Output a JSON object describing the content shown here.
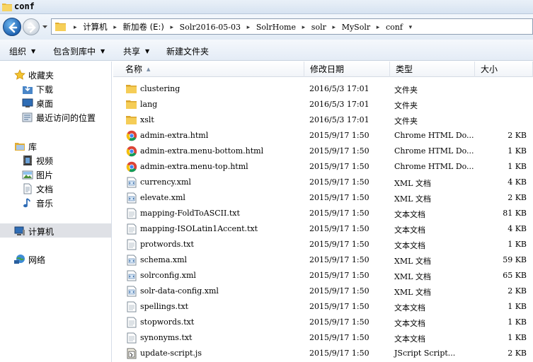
{
  "window": {
    "title": "conf"
  },
  "address": {
    "crumbs": [
      "计算机",
      "新加卷 (E:)",
      "Solr2016-05-03",
      "SolrHome",
      "solr",
      "MySolr",
      "conf"
    ]
  },
  "toolbar": {
    "organize": "组织",
    "include_library": "包含到库中",
    "share": "共享",
    "new_folder": "新建文件夹"
  },
  "nav": {
    "favorites": "收藏夹",
    "downloads": "下载",
    "desktop": "桌面",
    "recent": "最近访问的位置",
    "libraries": "库",
    "videos": "视频",
    "pictures": "图片",
    "documents": "文档",
    "music": "音乐",
    "computer": "计算机",
    "network": "网络"
  },
  "columns": {
    "name": "名称",
    "date": "修改日期",
    "type": "类型",
    "size": "大小"
  },
  "files": [
    {
      "icon": "folder-icon",
      "name": "clustering",
      "date": "2016/5/3 17:01",
      "type": "文件夹",
      "size": ""
    },
    {
      "icon": "folder-icon",
      "name": "lang",
      "date": "2016/5/3 17:01",
      "type": "文件夹",
      "size": ""
    },
    {
      "icon": "folder-icon",
      "name": "xslt",
      "date": "2016/5/3 17:01",
      "type": "文件夹",
      "size": ""
    },
    {
      "icon": "chrome-icon",
      "name": "admin-extra.html",
      "date": "2015/9/17 1:50",
      "type": "Chrome HTML Do...",
      "size": "2 KB"
    },
    {
      "icon": "chrome-icon",
      "name": "admin-extra.menu-bottom.html",
      "date": "2015/9/17 1:50",
      "type": "Chrome HTML Do...",
      "size": "1 KB"
    },
    {
      "icon": "chrome-icon",
      "name": "admin-extra.menu-top.html",
      "date": "2015/9/17 1:50",
      "type": "Chrome HTML Do...",
      "size": "1 KB"
    },
    {
      "icon": "xml-icon",
      "name": "currency.xml",
      "date": "2015/9/17 1:50",
      "type": "XML 文档",
      "size": "4 KB"
    },
    {
      "icon": "xml-icon",
      "name": "elevate.xml",
      "date": "2015/9/17 1:50",
      "type": "XML 文档",
      "size": "2 KB"
    },
    {
      "icon": "text-file-icon",
      "name": "mapping-FoldToASCII.txt",
      "date": "2015/9/17 1:50",
      "type": "文本文档",
      "size": "81 KB"
    },
    {
      "icon": "text-file-icon",
      "name": "mapping-ISOLatin1Accent.txt",
      "date": "2015/9/17 1:50",
      "type": "文本文档",
      "size": "4 KB"
    },
    {
      "icon": "text-file-icon",
      "name": "protwords.txt",
      "date": "2015/9/17 1:50",
      "type": "文本文档",
      "size": "1 KB"
    },
    {
      "icon": "xml-icon",
      "name": "schema.xml",
      "date": "2015/9/17 1:50",
      "type": "XML 文档",
      "size": "59 KB"
    },
    {
      "icon": "xml-icon",
      "name": "solrconfig.xml",
      "date": "2015/9/17 1:50",
      "type": "XML 文档",
      "size": "65 KB"
    },
    {
      "icon": "xml-icon",
      "name": "solr-data-config.xml",
      "date": "2015/9/17 1:50",
      "type": "XML 文档",
      "size": "2 KB"
    },
    {
      "icon": "text-file-icon",
      "name": "spellings.txt",
      "date": "2015/9/17 1:50",
      "type": "文本文档",
      "size": "1 KB"
    },
    {
      "icon": "text-file-icon",
      "name": "stopwords.txt",
      "date": "2015/9/17 1:50",
      "type": "文本文档",
      "size": "1 KB"
    },
    {
      "icon": "text-file-icon",
      "name": "synonyms.txt",
      "date": "2015/9/17 1:50",
      "type": "文本文档",
      "size": "1 KB"
    },
    {
      "icon": "jscript-icon",
      "name": "update-script.js",
      "date": "2015/9/17 1:50",
      "type": "JScript Script...",
      "size": "2 KB"
    }
  ]
}
